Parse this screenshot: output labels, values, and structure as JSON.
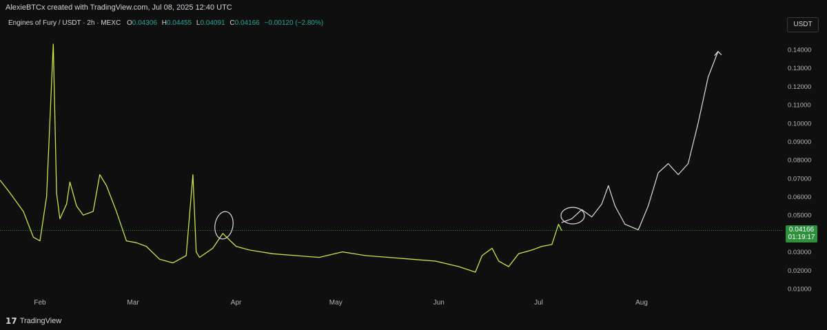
{
  "header": {
    "attribution": "AlexieBTCx created with TradingView.com, Jul 08, 2025 12:40 UTC"
  },
  "legend": {
    "symbol": "Engines of Fury / USDT · 2h · MEXC",
    "open_label": "O",
    "open": "0.04306",
    "high_label": "H",
    "high": "0.04455",
    "low_label": "L",
    "low": "0.04091",
    "close_label": "C",
    "close": "0.04166",
    "change": "−0.00120 (−2.80%)"
  },
  "price_axis": {
    "unit": "USDT"
  },
  "last_price": {
    "value": "0.04166",
    "countdown": "01:19:17"
  },
  "footer": {
    "brand": "TradingView"
  },
  "colors": {
    "line": "#c6e84a",
    "price_tag": "#2e8f3c",
    "projection": "#e0e0e0",
    "up": "#26a69a"
  },
  "chart_data": {
    "type": "line",
    "title": "Engines of Fury / USDT · 2h · MEXC",
    "xlabel": "",
    "ylabel": "",
    "y_unit": "USDT",
    "ylim": [
      0.005,
      0.148
    ],
    "x_ticks": [
      "Feb",
      "Mar",
      "Apr",
      "May",
      "Jun",
      "Jul",
      "Aug"
    ],
    "y_ticks": [
      "0.01000",
      "0.02000",
      "0.03000",
      "0.04000",
      "0.05000",
      "0.06000",
      "0.07000",
      "0.08000",
      "0.09000",
      "0.10000",
      "0.11000",
      "0.12000",
      "0.13000",
      "0.14000"
    ],
    "grid": false,
    "last_price": 0.04166,
    "series": [
      {
        "kind": "price",
        "x": [
          "2025-01-20",
          "2025-01-23",
          "2025-01-27",
          "2025-01-30",
          "2025-02-01",
          "2025-02-03",
          "2025-02-04",
          "2025-02-05",
          "2025-02-06",
          "2025-02-07",
          "2025-02-09",
          "2025-02-10",
          "2025-02-12",
          "2025-02-14",
          "2025-02-17",
          "2025-02-19",
          "2025-02-21",
          "2025-02-24",
          "2025-02-27",
          "2025-03-02",
          "2025-03-05",
          "2025-03-09",
          "2025-03-13",
          "2025-03-17",
          "2025-03-19",
          "2025-03-20",
          "2025-03-21",
          "2025-03-25",
          "2025-03-28",
          "2025-04-01",
          "2025-04-05",
          "2025-04-12",
          "2025-04-19",
          "2025-04-26",
          "2025-05-03",
          "2025-05-10",
          "2025-05-17",
          "2025-05-24",
          "2025-05-31",
          "2025-06-07",
          "2025-06-12",
          "2025-06-14",
          "2025-06-17",
          "2025-06-19",
          "2025-06-22",
          "2025-06-25",
          "2025-06-29",
          "2025-07-02",
          "2025-07-05",
          "2025-07-07",
          "2025-07-08"
        ],
        "y": [
          0.069,
          0.062,
          0.052,
          0.038,
          0.036,
          0.06,
          0.102,
          0.143,
          0.062,
          0.048,
          0.056,
          0.068,
          0.055,
          0.05,
          0.052,
          0.072,
          0.066,
          0.052,
          0.036,
          0.035,
          0.033,
          0.026,
          0.024,
          0.028,
          0.072,
          0.03,
          0.027,
          0.032,
          0.04,
          0.033,
          0.031,
          0.029,
          0.028,
          0.027,
          0.03,
          0.028,
          0.027,
          0.026,
          0.025,
          0.022,
          0.019,
          0.028,
          0.032,
          0.025,
          0.022,
          0.029,
          0.031,
          0.033,
          0.034,
          0.045,
          0.0416
        ]
      },
      {
        "kind": "projection",
        "x": [
          "2025-07-08",
          "2025-07-11",
          "2025-07-14",
          "2025-07-17",
          "2025-07-20",
          "2025-07-22",
          "2025-07-24",
          "2025-07-27",
          "2025-07-31",
          "2025-08-03",
          "2025-08-06",
          "2025-08-09",
          "2025-08-12",
          "2025-08-15",
          "2025-08-18",
          "2025-08-21",
          "2025-08-24"
        ],
        "y": [
          0.046,
          0.048,
          0.053,
          0.049,
          0.056,
          0.066,
          0.055,
          0.045,
          0.042,
          0.055,
          0.073,
          0.078,
          0.072,
          0.078,
          0.1,
          0.125,
          0.139
        ]
      }
    ]
  }
}
